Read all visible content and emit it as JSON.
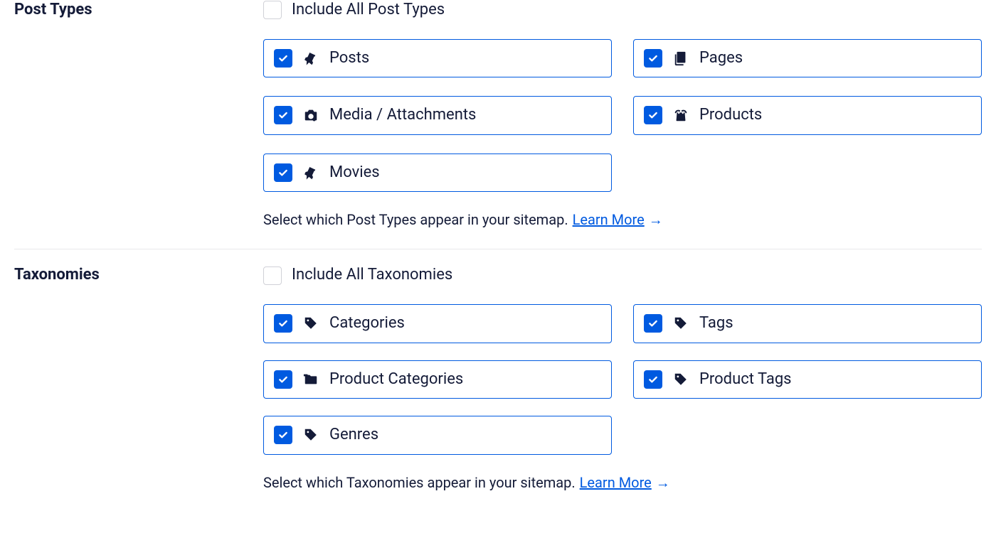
{
  "postTypes": {
    "title": "Post Types",
    "includeAllLabel": "Include All Post Types",
    "includeAllChecked": false,
    "items": [
      {
        "label": "Posts",
        "icon": "pin",
        "checked": true
      },
      {
        "label": "Pages",
        "icon": "pages",
        "checked": true
      },
      {
        "label": "Media / Attachments",
        "icon": "camera",
        "checked": true
      },
      {
        "label": "Products",
        "icon": "bag",
        "checked": true
      },
      {
        "label": "Movies",
        "icon": "pin",
        "checked": true
      }
    ],
    "helperText": "Select which Post Types appear in your sitemap.",
    "learnMore": "Learn More"
  },
  "taxonomies": {
    "title": "Taxonomies",
    "includeAllLabel": "Include All Taxonomies",
    "includeAllChecked": false,
    "items": [
      {
        "label": "Categories",
        "icon": "tag",
        "checked": true
      },
      {
        "label": "Tags",
        "icon": "tag",
        "checked": true
      },
      {
        "label": "Product Categories",
        "icon": "folder",
        "checked": true
      },
      {
        "label": "Product Tags",
        "icon": "tag",
        "checked": true
      },
      {
        "label": "Genres",
        "icon": "tag",
        "checked": true
      }
    ],
    "helperText": "Select which Taxonomies appear in your sitemap.",
    "learnMore": "Learn More"
  }
}
